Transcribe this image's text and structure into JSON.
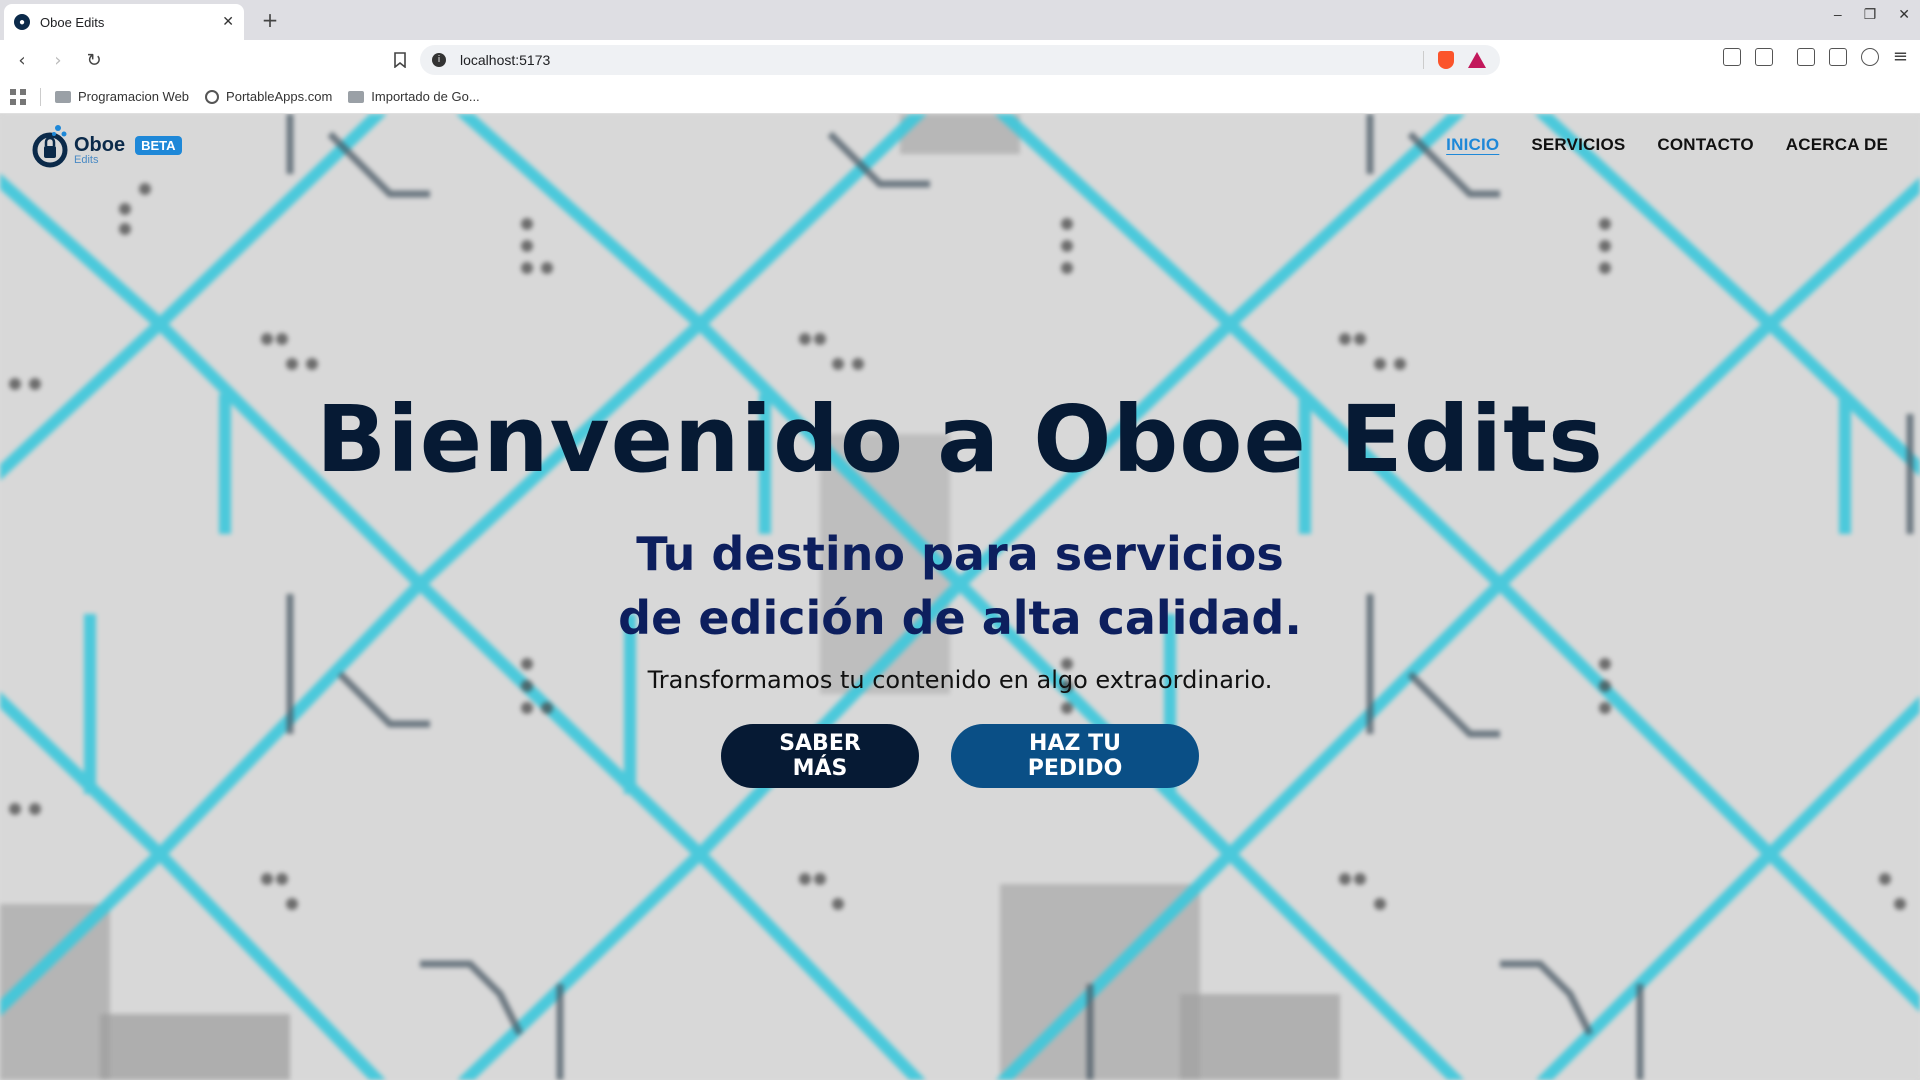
{
  "browser": {
    "tab_title": "Oboe Edits",
    "new_tab_symbol": "+",
    "close_symbol": "✕",
    "url": "localhost:5173",
    "bookmarks": [
      {
        "label": "Programacion Web",
        "icon": "folder-icon"
      },
      {
        "label": "PortableApps.com",
        "icon": "globe-icon"
      },
      {
        "label": "Importado de Go...",
        "icon": "folder-icon"
      }
    ],
    "window_controls": [
      "–",
      "❐",
      "✕"
    ]
  },
  "site": {
    "logo": {
      "name": "Oboe",
      "sub": "Edits",
      "badge": "BETA"
    },
    "nav": [
      {
        "label": "INICIO",
        "active": true
      },
      {
        "label": "SERVICIOS",
        "active": false
      },
      {
        "label": "CONTACTO",
        "active": false
      },
      {
        "label": "ACERCA DE",
        "active": false
      }
    ],
    "hero": {
      "title": "Bienvenido a Oboe Edits",
      "subtitle_line1": "Tu destino para servicios",
      "subtitle_line2": "de edición de alta calidad.",
      "description": "Transformamos tu contenido en algo extraordinario.",
      "primary_button": "SABER MÁS",
      "secondary_button": "HAZ TU PEDIDO"
    }
  },
  "colors": {
    "accent": "#1e88d8",
    "navy": "#061a34",
    "button_blue": "#0a4f86",
    "pattern_cyan": "#3cc8dc"
  }
}
